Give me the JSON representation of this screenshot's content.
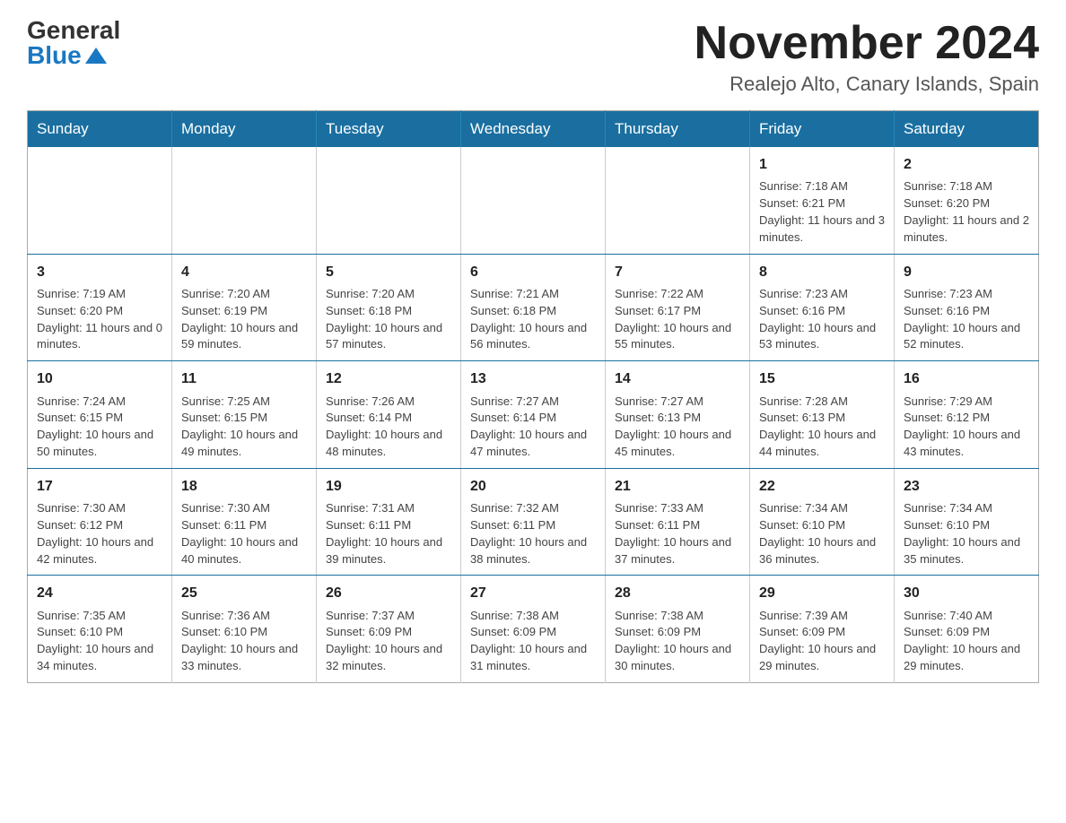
{
  "header": {
    "month_title": "November 2024",
    "location": "Realejo Alto, Canary Islands, Spain",
    "logo_general": "General",
    "logo_blue": "Blue"
  },
  "calendar": {
    "days_of_week": [
      "Sunday",
      "Monday",
      "Tuesday",
      "Wednesday",
      "Thursday",
      "Friday",
      "Saturday"
    ],
    "weeks": [
      [
        {
          "day": "",
          "info": ""
        },
        {
          "day": "",
          "info": ""
        },
        {
          "day": "",
          "info": ""
        },
        {
          "day": "",
          "info": ""
        },
        {
          "day": "",
          "info": ""
        },
        {
          "day": "1",
          "info": "Sunrise: 7:18 AM\nSunset: 6:21 PM\nDaylight: 11 hours and 3 minutes."
        },
        {
          "day": "2",
          "info": "Sunrise: 7:18 AM\nSunset: 6:20 PM\nDaylight: 11 hours and 2 minutes."
        }
      ],
      [
        {
          "day": "3",
          "info": "Sunrise: 7:19 AM\nSunset: 6:20 PM\nDaylight: 11 hours and 0 minutes."
        },
        {
          "day": "4",
          "info": "Sunrise: 7:20 AM\nSunset: 6:19 PM\nDaylight: 10 hours and 59 minutes."
        },
        {
          "day": "5",
          "info": "Sunrise: 7:20 AM\nSunset: 6:18 PM\nDaylight: 10 hours and 57 minutes."
        },
        {
          "day": "6",
          "info": "Sunrise: 7:21 AM\nSunset: 6:18 PM\nDaylight: 10 hours and 56 minutes."
        },
        {
          "day": "7",
          "info": "Sunrise: 7:22 AM\nSunset: 6:17 PM\nDaylight: 10 hours and 55 minutes."
        },
        {
          "day": "8",
          "info": "Sunrise: 7:23 AM\nSunset: 6:16 PM\nDaylight: 10 hours and 53 minutes."
        },
        {
          "day": "9",
          "info": "Sunrise: 7:23 AM\nSunset: 6:16 PM\nDaylight: 10 hours and 52 minutes."
        }
      ],
      [
        {
          "day": "10",
          "info": "Sunrise: 7:24 AM\nSunset: 6:15 PM\nDaylight: 10 hours and 50 minutes."
        },
        {
          "day": "11",
          "info": "Sunrise: 7:25 AM\nSunset: 6:15 PM\nDaylight: 10 hours and 49 minutes."
        },
        {
          "day": "12",
          "info": "Sunrise: 7:26 AM\nSunset: 6:14 PM\nDaylight: 10 hours and 48 minutes."
        },
        {
          "day": "13",
          "info": "Sunrise: 7:27 AM\nSunset: 6:14 PM\nDaylight: 10 hours and 47 minutes."
        },
        {
          "day": "14",
          "info": "Sunrise: 7:27 AM\nSunset: 6:13 PM\nDaylight: 10 hours and 45 minutes."
        },
        {
          "day": "15",
          "info": "Sunrise: 7:28 AM\nSunset: 6:13 PM\nDaylight: 10 hours and 44 minutes."
        },
        {
          "day": "16",
          "info": "Sunrise: 7:29 AM\nSunset: 6:12 PM\nDaylight: 10 hours and 43 minutes."
        }
      ],
      [
        {
          "day": "17",
          "info": "Sunrise: 7:30 AM\nSunset: 6:12 PM\nDaylight: 10 hours and 42 minutes."
        },
        {
          "day": "18",
          "info": "Sunrise: 7:30 AM\nSunset: 6:11 PM\nDaylight: 10 hours and 40 minutes."
        },
        {
          "day": "19",
          "info": "Sunrise: 7:31 AM\nSunset: 6:11 PM\nDaylight: 10 hours and 39 minutes."
        },
        {
          "day": "20",
          "info": "Sunrise: 7:32 AM\nSunset: 6:11 PM\nDaylight: 10 hours and 38 minutes."
        },
        {
          "day": "21",
          "info": "Sunrise: 7:33 AM\nSunset: 6:11 PM\nDaylight: 10 hours and 37 minutes."
        },
        {
          "day": "22",
          "info": "Sunrise: 7:34 AM\nSunset: 6:10 PM\nDaylight: 10 hours and 36 minutes."
        },
        {
          "day": "23",
          "info": "Sunrise: 7:34 AM\nSunset: 6:10 PM\nDaylight: 10 hours and 35 minutes."
        }
      ],
      [
        {
          "day": "24",
          "info": "Sunrise: 7:35 AM\nSunset: 6:10 PM\nDaylight: 10 hours and 34 minutes."
        },
        {
          "day": "25",
          "info": "Sunrise: 7:36 AM\nSunset: 6:10 PM\nDaylight: 10 hours and 33 minutes."
        },
        {
          "day": "26",
          "info": "Sunrise: 7:37 AM\nSunset: 6:09 PM\nDaylight: 10 hours and 32 minutes."
        },
        {
          "day": "27",
          "info": "Sunrise: 7:38 AM\nSunset: 6:09 PM\nDaylight: 10 hours and 31 minutes."
        },
        {
          "day": "28",
          "info": "Sunrise: 7:38 AM\nSunset: 6:09 PM\nDaylight: 10 hours and 30 minutes."
        },
        {
          "day": "29",
          "info": "Sunrise: 7:39 AM\nSunset: 6:09 PM\nDaylight: 10 hours and 29 minutes."
        },
        {
          "day": "30",
          "info": "Sunrise: 7:40 AM\nSunset: 6:09 PM\nDaylight: 10 hours and 29 minutes."
        }
      ]
    ]
  }
}
